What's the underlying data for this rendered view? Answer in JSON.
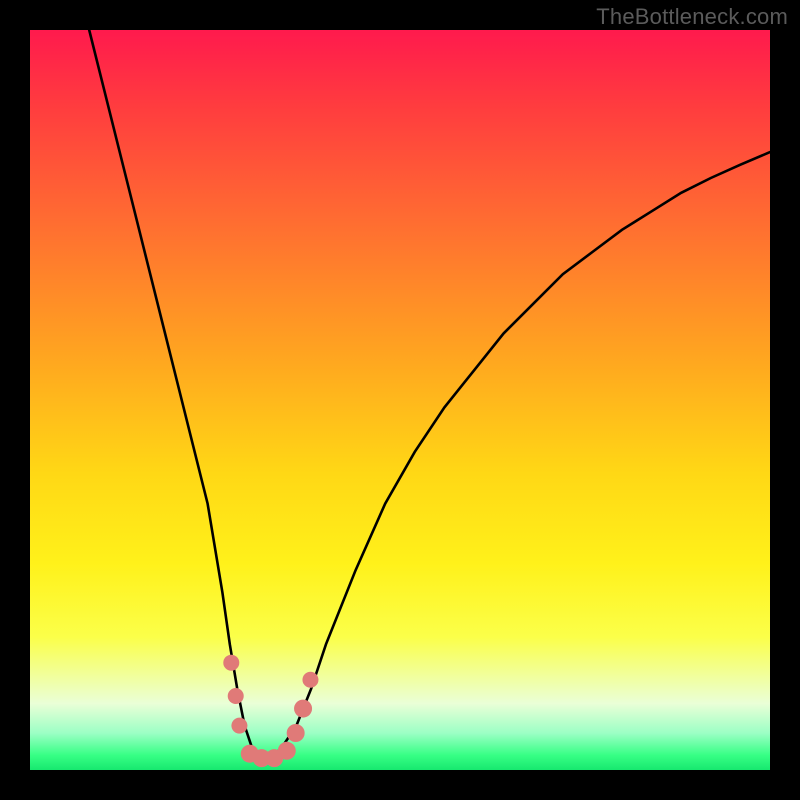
{
  "watermark": "TheBottleneck.com",
  "colors": {
    "frame": "#000000",
    "curve_stroke": "#000000",
    "marker_fill": "#e07a78",
    "gradient_top": "#ff1a4d",
    "gradient_bottom": "#17e86f"
  },
  "chart_data": {
    "type": "line",
    "title": "",
    "xlabel": "",
    "ylabel": "",
    "xlim": [
      0,
      100
    ],
    "ylim": [
      0,
      100
    ],
    "grid": false,
    "series": [
      {
        "name": "bottleneck-curve",
        "x": [
          8,
          10,
          12,
          14,
          16,
          18,
          20,
          22,
          24,
          26,
          27,
          28,
          29,
          30,
          31,
          32,
          33,
          34,
          36,
          38,
          40,
          44,
          48,
          52,
          56,
          60,
          64,
          68,
          72,
          76,
          80,
          84,
          88,
          92,
          96,
          100
        ],
        "y": [
          100,
          92,
          84,
          76,
          68,
          60,
          52,
          44,
          36,
          24,
          17,
          11,
          6,
          3,
          2,
          2,
          2,
          3,
          6,
          11,
          17,
          27,
          36,
          43,
          49,
          54,
          59,
          63,
          67,
          70,
          73,
          75.5,
          78,
          80,
          81.8,
          83.5
        ]
      }
    ],
    "markers": [
      {
        "x": 27.2,
        "y": 14.5,
        "r": 8
      },
      {
        "x": 27.8,
        "y": 10.0,
        "r": 8
      },
      {
        "x": 28.3,
        "y": 6.0,
        "r": 8
      },
      {
        "x": 29.7,
        "y": 2.2,
        "r": 9
      },
      {
        "x": 31.3,
        "y": 1.6,
        "r": 9
      },
      {
        "x": 33.0,
        "y": 1.6,
        "r": 9
      },
      {
        "x": 34.7,
        "y": 2.6,
        "r": 9
      },
      {
        "x": 35.9,
        "y": 5.0,
        "r": 9
      },
      {
        "x": 36.9,
        "y": 8.3,
        "r": 9
      },
      {
        "x": 37.9,
        "y": 12.2,
        "r": 8
      }
    ]
  }
}
